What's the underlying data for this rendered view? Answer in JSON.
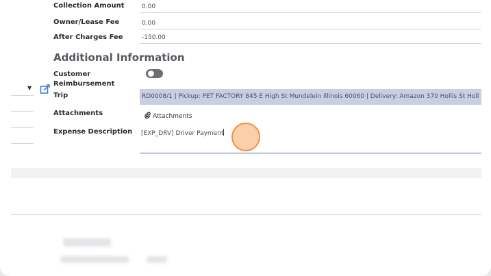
{
  "fields": {
    "collection_amount": {
      "label": "Collection Amount",
      "value": "0.00"
    },
    "owner_lease_fee": {
      "label": "Owner/Lease Fee",
      "value": "0.00"
    },
    "after_charges_fee": {
      "label": "After Charges Fee",
      "value": "-150.00"
    }
  },
  "section": {
    "title": "Additional Information"
  },
  "customer_reimbursement": {
    "label": "Customer Reimbursement",
    "enabled": false
  },
  "trip": {
    "label": "Trip",
    "value": "RD0008/1 | Pickup: PET FACTORY 845 E High St Mundelein Illinois 60060 | Delivery: Amazon 370 Hollis St Holl"
  },
  "attachments": {
    "label": "Attachments",
    "button_label": "Attachments"
  },
  "expense_description": {
    "label": "Expense Description",
    "value": "[EXP_DRV] Driver Payment"
  },
  "icons": {
    "dropdown": "chevron-down-icon",
    "edit": "external-edit-icon",
    "paperclip": "paperclip-icon"
  },
  "colors": {
    "trip_field_bg": "#c8cfe4",
    "input_underline": "#4c6fa1",
    "click_marker": "#f0914a"
  }
}
